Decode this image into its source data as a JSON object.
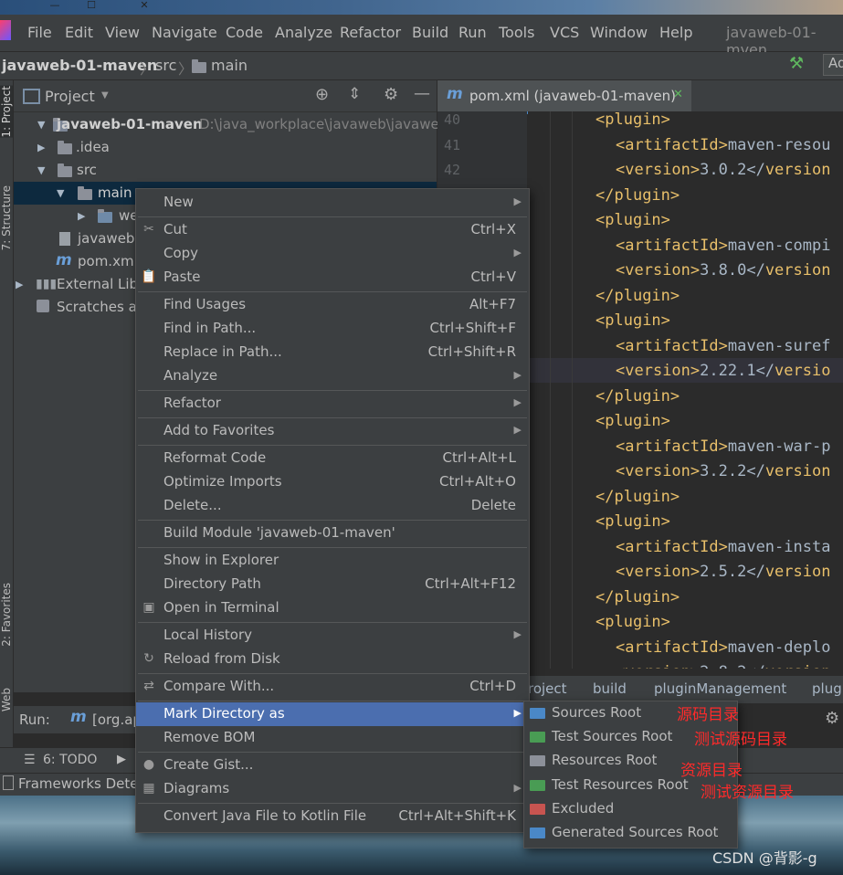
{
  "colors": {
    "accent": "#4b6eaf",
    "annotation_red": "#ff2a2a",
    "tag_yellow": "#e8bf6a",
    "source_folder": "#4a88c7",
    "test_folder": "#499c54",
    "resource_folder": "#8c9099",
    "excluded_folder": "#c75450",
    "generated_folder": "#4a88c7"
  },
  "menubar": {
    "items": [
      "File",
      "Edit",
      "View",
      "Navigate",
      "Code",
      "Analyze",
      "Refactor",
      "Build",
      "Run",
      "Tools",
      "VCS",
      "Window",
      "Help"
    ],
    "window_title": "javaweb-01-mven"
  },
  "navbar": {
    "crumbs": [
      "javaweb-01-maven",
      "src",
      "main"
    ],
    "right_button": "Ad"
  },
  "left_strip": {
    "project_tab": "1: Project",
    "structure_tab": "7: Structure",
    "favorites_tab": "2: Favorites",
    "web_tab": "Web"
  },
  "project_panel": {
    "title": "Project",
    "tree": [
      {
        "label": "javaweb-01-maven",
        "path": "D:\\java_workplace\\javaweb\\javaweb"
      },
      {
        "label": ".idea"
      },
      {
        "label": "src"
      },
      {
        "label": "main"
      },
      {
        "label": "we"
      },
      {
        "label": "javaweb-"
      },
      {
        "label": "pom.xml"
      },
      {
        "label": "External Libr"
      },
      {
        "label": "Scratches ar"
      }
    ]
  },
  "editor": {
    "tab_label": "pom.xml (javaweb-01-maven)",
    "line_numbers": [
      "40",
      "41",
      "42"
    ],
    "lines": [
      {
        "indent": 3,
        "open": "<",
        "tag": "plugin",
        "close": ">",
        "text": ""
      },
      {
        "indent": 4,
        "open": "<",
        "tag": "artifactId",
        "close": ">",
        "text": "maven-resou"
      },
      {
        "indent": 4,
        "open": "<",
        "tag": "version",
        "close": ">",
        "text": "3.0.2</",
        "tail": "version"
      },
      {
        "indent": 3,
        "open": "</",
        "tag": "plugin",
        "close": ">",
        "text": ""
      },
      {
        "indent": 3,
        "open": "<",
        "tag": "plugin",
        "close": ">",
        "text": ""
      },
      {
        "indent": 4,
        "open": "<",
        "tag": "artifactId",
        "close": ">",
        "text": "maven-compi"
      },
      {
        "indent": 4,
        "open": "<",
        "tag": "version",
        "close": ">",
        "text": "3.8.0</",
        "tail": "version"
      },
      {
        "indent": 3,
        "open": "</",
        "tag": "plugin",
        "close": ">",
        "text": ""
      },
      {
        "indent": 3,
        "open": "<",
        "tag": "plugin",
        "close": ">",
        "text": ""
      },
      {
        "indent": 4,
        "open": "<",
        "tag": "artifactId",
        "close": ">",
        "text": "maven-suref"
      },
      {
        "indent": 4,
        "open": "<",
        "tag": "version",
        "close": ">",
        "text": "2.22.1</",
        "tail": "versio"
      },
      {
        "indent": 3,
        "open": "</",
        "tag": "plugin",
        "close": ">",
        "text": ""
      },
      {
        "indent": 3,
        "open": "<",
        "tag": "plugin",
        "close": ">",
        "text": ""
      },
      {
        "indent": 4,
        "open": "<",
        "tag": "artifactId",
        "close": ">",
        "text": "maven-war-p"
      },
      {
        "indent": 4,
        "open": "<",
        "tag": "version",
        "close": ">",
        "text": "3.2.2</",
        "tail": "version"
      },
      {
        "indent": 3,
        "open": "</",
        "tag": "plugin",
        "close": ">",
        "text": ""
      },
      {
        "indent": 3,
        "open": "<",
        "tag": "plugin",
        "close": ">",
        "text": ""
      },
      {
        "indent": 4,
        "open": "<",
        "tag": "artifactId",
        "close": ">",
        "text": "maven-insta"
      },
      {
        "indent": 4,
        "open": "<",
        "tag": "version",
        "close": ">",
        "text": "2.5.2</",
        "tail": "version"
      },
      {
        "indent": 3,
        "open": "</",
        "tag": "plugin",
        "close": ">",
        "text": ""
      },
      {
        "indent": 3,
        "open": "<",
        "tag": "plugin",
        "close": ">",
        "text": ""
      },
      {
        "indent": 4,
        "open": "<",
        "tag": "artifactId",
        "close": ">",
        "text": "maven-deplo"
      },
      {
        "indent": 4,
        "open": "<",
        "tag": "version",
        "close": ">",
        "text": "2.8.2</",
        "tail": "version"
      }
    ],
    "breadcrumb": [
      "roject",
      "build",
      "pluginManagement",
      "plug"
    ]
  },
  "run_panel": {
    "label": "Run:",
    "config": "[org.ap"
  },
  "bottom_tabs": {
    "todo": "6: TODO"
  },
  "status": {
    "text": "Frameworks Dete"
  },
  "context_menu": {
    "items": [
      {
        "label": "New",
        "shortcut": "",
        "submenu": true,
        "icon": ""
      },
      {
        "label": "Cut",
        "shortcut": "Ctrl+X",
        "submenu": false,
        "icon": "scissors-icon"
      },
      {
        "label": "Copy",
        "shortcut": "",
        "submenu": true,
        "icon": ""
      },
      {
        "label": "Paste",
        "shortcut": "Ctrl+V",
        "submenu": false,
        "icon": "clipboard-icon"
      },
      {
        "label": "Find Usages",
        "shortcut": "Alt+F7",
        "submenu": false,
        "icon": ""
      },
      {
        "label": "Find in Path...",
        "shortcut": "Ctrl+Shift+F",
        "submenu": false,
        "icon": ""
      },
      {
        "label": "Replace in Path...",
        "shortcut": "Ctrl+Shift+R",
        "submenu": false,
        "icon": ""
      },
      {
        "label": "Analyze",
        "shortcut": "",
        "submenu": true,
        "icon": ""
      },
      {
        "label": "Refactor",
        "shortcut": "",
        "submenu": true,
        "icon": ""
      },
      {
        "label": "Add to Favorites",
        "shortcut": "",
        "submenu": true,
        "icon": ""
      },
      {
        "label": "Reformat Code",
        "shortcut": "Ctrl+Alt+L",
        "submenu": false,
        "icon": ""
      },
      {
        "label": "Optimize Imports",
        "shortcut": "Ctrl+Alt+O",
        "submenu": false,
        "icon": ""
      },
      {
        "label": "Delete...",
        "shortcut": "Delete",
        "submenu": false,
        "icon": ""
      },
      {
        "label": "Build Module 'javaweb-01-maven'",
        "shortcut": "",
        "submenu": false,
        "icon": ""
      },
      {
        "label": "Show in Explorer",
        "shortcut": "",
        "submenu": false,
        "icon": ""
      },
      {
        "label": "Directory Path",
        "shortcut": "Ctrl+Alt+F12",
        "submenu": false,
        "icon": ""
      },
      {
        "label": "Open in Terminal",
        "shortcut": "",
        "submenu": false,
        "icon": "terminal-icon"
      },
      {
        "label": "Local History",
        "shortcut": "",
        "submenu": true,
        "icon": ""
      },
      {
        "label": "Reload from Disk",
        "shortcut": "",
        "submenu": false,
        "icon": "reload-icon"
      },
      {
        "label": "Compare With...",
        "shortcut": "Ctrl+D",
        "submenu": false,
        "icon": "compare-icon"
      },
      {
        "label": "Mark Directory as",
        "shortcut": "",
        "submenu": true,
        "icon": "",
        "highlighted": true
      },
      {
        "label": "Remove BOM",
        "shortcut": "",
        "submenu": false,
        "icon": ""
      },
      {
        "label": "Create Gist...",
        "shortcut": "",
        "submenu": false,
        "icon": "github-icon"
      },
      {
        "label": "Diagrams",
        "shortcut": "",
        "submenu": true,
        "icon": "diagram-icon"
      },
      {
        "label": "Convert Java File to Kotlin File",
        "shortcut": "Ctrl+Alt+Shift+K",
        "submenu": false,
        "icon": ""
      }
    ]
  },
  "submenu": {
    "items": [
      {
        "label": "Sources Root",
        "icon": "sources-root-folder-icon"
      },
      {
        "label": "Test Sources Root",
        "icon": "test-sources-root-folder-icon"
      },
      {
        "label": "Resources Root",
        "icon": "resources-root-folder-icon"
      },
      {
        "label": "Test Resources Root",
        "icon": "test-resources-root-folder-icon"
      },
      {
        "label": "Excluded",
        "icon": "excluded-folder-icon"
      },
      {
        "label": "Generated Sources Root",
        "icon": "generated-sources-folder-icon"
      }
    ]
  },
  "annotations": [
    "源码目录",
    "测试源码目录",
    "资源目录",
    "测试资源目录"
  ],
  "watermark": "CSDN @背影-g"
}
